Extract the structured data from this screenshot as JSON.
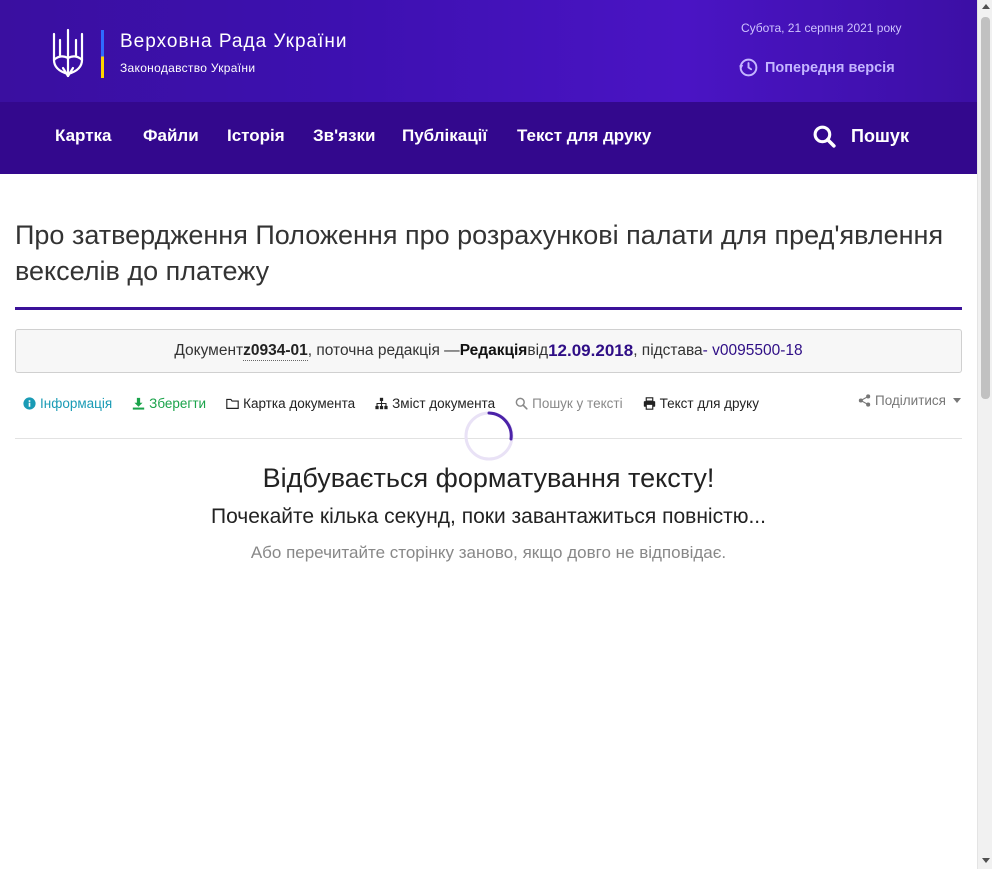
{
  "header": {
    "title": "Верховна Рада України",
    "subtitle": "Законодавство України",
    "date": "Субота, 21 серпня 2021 року",
    "prev_version": "Попередня версія"
  },
  "nav": {
    "items": [
      {
        "label": "Картка"
      },
      {
        "label": "Файли"
      },
      {
        "label": "Історія"
      },
      {
        "label": "Зв'язки"
      },
      {
        "label": "Публікації"
      },
      {
        "label": "Текст для друку"
      }
    ],
    "search": "Пошук"
  },
  "document": {
    "title": "Про затвердження Положення про розрахункові палати для пред'явлення векселів до платежу",
    "prefix": "Документ ",
    "code": "z0934-01",
    "current": ", поточна редакція — ",
    "edition_label": "Редакція",
    "from": " від ",
    "edition_date": "12.09.2018",
    "basis_label": ", підстава ",
    "basis_link": "- v0095500-18"
  },
  "toolbar": {
    "info": "Інформація",
    "save": "Зберегти",
    "card": "Картка документа",
    "toc": "Зміст документа",
    "search": "Пошук у тексті",
    "print": "Текст для друку",
    "share": "Поділитися"
  },
  "loading": {
    "heading": "Відбувається форматування тексту!",
    "wait": "Почекайте кілька секунд, поки завантажиться повністю...",
    "reload": "Або перечитайте сторінку заново, якщо довго не відповідає."
  },
  "colors": {
    "header": "#3d10b0",
    "nav": "#33088d",
    "accent": "#3b1299",
    "info": "#1a9bb5",
    "save": "#1aa34a"
  }
}
